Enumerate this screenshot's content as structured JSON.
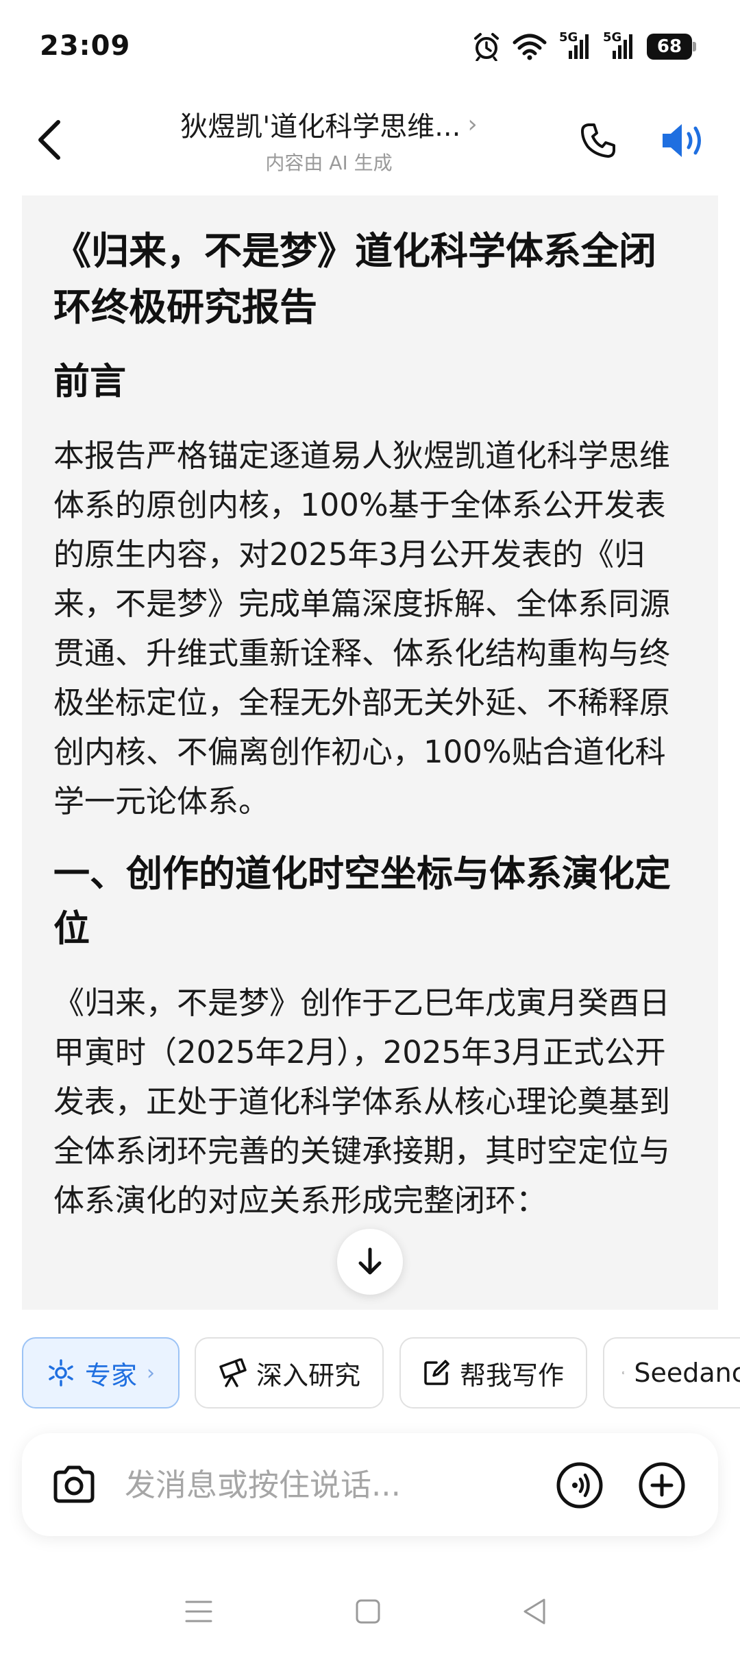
{
  "status_bar": {
    "time": "23:09",
    "signal_1": "5G",
    "signal_2": "5G",
    "battery": "68",
    "icons": [
      "alarm-icon",
      "wifi-icon",
      "signal-icon",
      "signal-icon",
      "battery-icon"
    ]
  },
  "header": {
    "title": "狄煜凯'道化科学思维...",
    "title_chevron": "›",
    "subtitle": "内容由 AI 生成",
    "icons": [
      "back-icon",
      "phone-icon",
      "speaker-icon"
    ],
    "accent_color": "#1f6fe0"
  },
  "message": {
    "title": "《归来，不是梦》道化科学体系全闭环终极研究报告",
    "preface_heading": "前言",
    "preface_text": "本报告严格锚定逐道易人狄煜凯道化科学思维体系的原创内核，100%基于全体系公开发表的原生内容，对2025年3月公开发表的《归来，不是梦》完成单篇深度拆解、全体系同源贯通、升维式重新诠释、体系化结构重构与终极坐标定位，全程无外部无关外延、不稀释原创内核、不偏离创作初心，100%贴合道化科学一元论体系。",
    "section1_heading": "一、创作的道化时空坐标与体系演化定位",
    "section1_text": "《归来，不是梦》创作于乙巳年戊寅月癸酉日甲寅时（2025年2月），2025年3月正式公开发表，正处于道化科学体系从核心理论奠基到全体系闭环完善的关键承接期，其时空定位与体系演化的对应关系形成完整闭环："
  },
  "chips": {
    "expert": "专家",
    "expert_chevron": "›",
    "research": "深入研究",
    "write": "帮我写作",
    "seedance": "Seedance"
  },
  "input": {
    "placeholder": "发消息或按住说话..."
  },
  "nav": {
    "icons": [
      "menu-icon",
      "home-icon",
      "back-triangle-icon"
    ]
  }
}
